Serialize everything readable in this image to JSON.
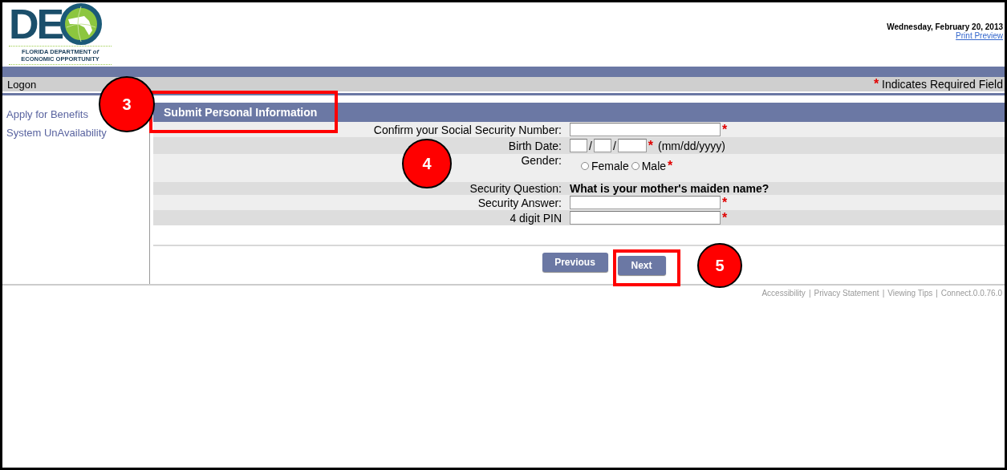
{
  "header": {
    "logo": {
      "letters": "DE",
      "line_1": "FLORIDA DEPARTMENT",
      "line_1_of": "of",
      "line_2": "ECONOMIC OPPORTUNITY"
    },
    "date": "Wednesday, February 20, 2013",
    "print_preview": "Print Preview"
  },
  "breadcrumb": "Logon",
  "required_mark": "*",
  "required_note": "Indicates Required Field",
  "sidebar": {
    "items": [
      {
        "label": "Apply for Benefits"
      },
      {
        "label": "System UnAvailability"
      }
    ]
  },
  "form": {
    "title": "Submit Personal Information",
    "rows": [
      {
        "kind": "text",
        "label": "Confirm your Social Security Number:",
        "required": true
      },
      {
        "kind": "date",
        "label": "Birth Date:",
        "separator": "/",
        "hint": "(mm/dd/yyyy)",
        "required": true
      },
      {
        "kind": "radio",
        "label": "Gender:",
        "options": [
          {
            "label": "Female",
            "selected": false
          },
          {
            "label": "Male",
            "selected": false
          }
        ],
        "required": true
      },
      {
        "kind": "question",
        "label": "Security Question:",
        "value": "What is your mother's maiden name?"
      },
      {
        "kind": "text",
        "label": "Security Answer:",
        "required": true
      },
      {
        "kind": "text",
        "label": "4 digit PIN",
        "required": true
      }
    ]
  },
  "buttons": [
    {
      "label": "Previous"
    },
    {
      "label": "Next"
    }
  ],
  "footer": {
    "separator": "|",
    "links": [
      {
        "label": "Accessibility"
      },
      {
        "label": "Privacy Statement"
      },
      {
        "label": "Viewing Tips"
      },
      {
        "label": "Connect.0.0.76.0"
      }
    ]
  },
  "callouts": [
    {
      "number": "3",
      "kind": "title"
    },
    {
      "number": "4",
      "kind": "form"
    },
    {
      "number": "5",
      "kind": "next"
    }
  ]
}
